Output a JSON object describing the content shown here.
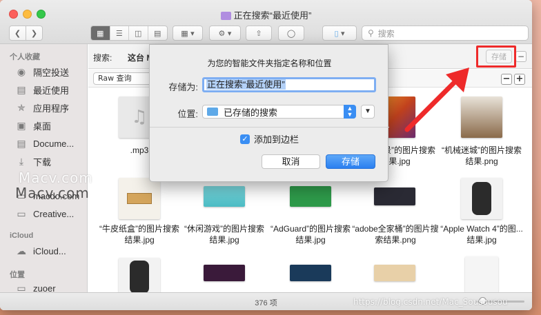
{
  "window": {
    "title": "正在搜索“最近使用”"
  },
  "toolbar": {
    "back_icon": "chevron-left-icon",
    "forward_icon": "chevron-right-icon",
    "search_placeholder": "搜索"
  },
  "sidebar": {
    "favorites_header": "个人收藏",
    "items": [
      {
        "label": "隔空投送",
        "icon": "airdrop-icon"
      },
      {
        "label": "最近使用",
        "icon": "recents-icon"
      },
      {
        "label": "应用程序",
        "icon": "applications-icon"
      },
      {
        "label": "桌面",
        "icon": "desktop-icon"
      },
      {
        "label": "Docume...",
        "icon": "documents-icon"
      },
      {
        "label": "下载",
        "icon": "downloads-icon"
      },
      {
        "label": "macdo.com",
        "icon": "file-icon"
      },
      {
        "label": "Creative...",
        "icon": "folder-icon"
      }
    ],
    "icloud_header": "iCloud",
    "icloud_items": [
      {
        "label": "iCloud...",
        "icon": "cloud-icon"
      }
    ],
    "locations_header": "位置",
    "location_items": [
      {
        "label": "zuoer",
        "icon": "disk-icon"
      }
    ]
  },
  "scope": {
    "label": "搜索:",
    "this_mac": "这台 M",
    "save_label": "存储",
    "minus": "−",
    "raw_query": "Raw 查询",
    "crit_minus": "−",
    "crit_plus": "+"
  },
  "files": [
    {
      "caption": ".mp3",
      "color": "#e9e9e9"
    },
    {
      "caption": "“渐变背景”的图片搜索结果.jpg",
      "color": "#c2421e"
    },
    {
      "caption": "“机械迷城”的图片搜索结果.png",
      "color": "#8a6a4a"
    },
    {
      "caption": "“牛皮纸盒”的图片搜索结果.jpg",
      "color": "#d4a55c"
    },
    {
      "caption": "“休闲游戏”的图片搜索结果.jpg",
      "color": "#4cbcc4"
    },
    {
      "caption": "“AdGuard”的图片搜索结果.jpg",
      "color": "#2e9a4a"
    },
    {
      "caption": "“adobe全家桶”的图片搜索结果.png",
      "color": "#2a2a34"
    },
    {
      "caption": "“Apple Watch 4”的图...结果.jpg",
      "color": "#2b2b2b"
    }
  ],
  "status": {
    "count": "376 项"
  },
  "dialog": {
    "title": "为您的智能文件夹指定名称和位置",
    "name_label": "存储为:",
    "name_value": "正在搜索“最近使用”",
    "location_label": "位置:",
    "location_value": "已存储的搜索",
    "add_sidebar_label": "添加到边栏",
    "add_sidebar_checked": true,
    "cancel_label": "取消",
    "save_label": "存储",
    "accent_color": "#3a8ef3"
  },
  "watermarks": {
    "wm1": "Macv.com",
    "wm2": "Macv.com",
    "wm3": "https://blog.csdn.net/Mac_Sousousou"
  },
  "annotation": {
    "highlight_color": "#ee2a2a"
  }
}
